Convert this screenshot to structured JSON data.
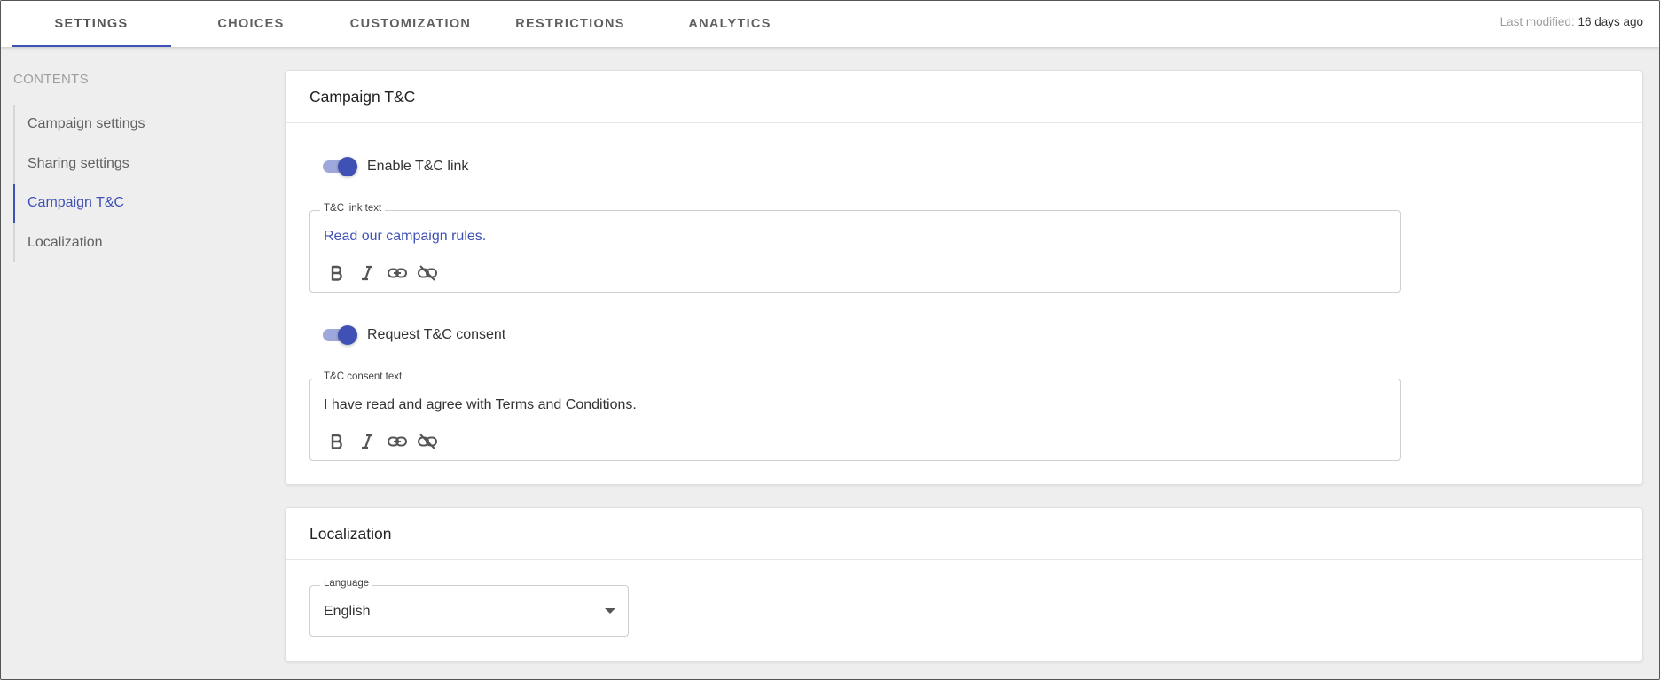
{
  "tabs": [
    {
      "label": "SETTINGS",
      "active": true
    },
    {
      "label": "CHOICES"
    },
    {
      "label": "CUSTOMIZATION"
    },
    {
      "label": "RESTRICTIONS"
    },
    {
      "label": "ANALYTICS"
    }
  ],
  "last_modified": {
    "label": "Last modified:",
    "value": "16 days ago"
  },
  "sidebar": {
    "title": "CONTENTS",
    "items": [
      {
        "label": "Campaign settings"
      },
      {
        "label": "Sharing settings"
      },
      {
        "label": "Campaign T&C",
        "active": true
      },
      {
        "label": "Localization"
      }
    ]
  },
  "tc_card": {
    "title": "Campaign T&C",
    "enable_link": {
      "label": "Enable T&C link",
      "on": true
    },
    "link_text_field": {
      "legend": "T&C link text",
      "value": "Read our campaign rules."
    },
    "request_consent": {
      "label": "Request T&C consent",
      "on": true
    },
    "consent_text_field": {
      "legend": "T&C consent text",
      "value": "I have read and agree with Terms and Conditions."
    }
  },
  "localization_card": {
    "title": "Localization",
    "language": {
      "legend": "Language",
      "value": "English"
    }
  },
  "colors": {
    "accent": "#3f51b5",
    "accent_light": "#9fa8da",
    "background": "#eeeeee"
  },
  "rte_tools": [
    "bold-icon",
    "italic-icon",
    "link-icon",
    "unlink-icon"
  ]
}
